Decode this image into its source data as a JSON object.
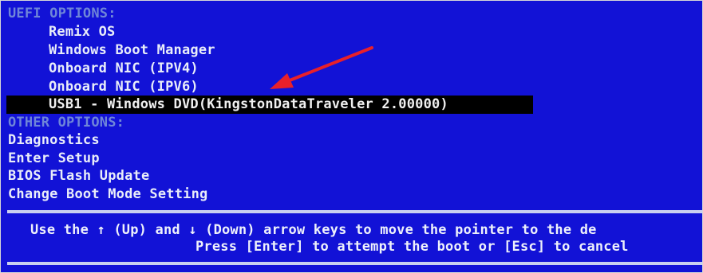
{
  "uefi": {
    "header": "UEFI OPTIONS:",
    "items": [
      "Remix OS",
      "Windows Boot Manager",
      "Onboard NIC (IPV4)",
      "Onboard NIC (IPV6)"
    ],
    "selected_item": "USB1 - Windows DVD(KingstonDataTraveler 2.00000)"
  },
  "other": {
    "header": "OTHER OPTIONS:",
    "items": [
      "Diagnostics",
      "Enter Setup",
      "BIOS Flash Update",
      "Change Boot Mode Setting"
    ]
  },
  "footer": {
    "line1": "Use the ↑ (Up) and ↓ (Down) arrow keys to move the pointer to the de",
    "line2": "Press [Enter] to attempt the boot or [Esc] to cancel"
  },
  "colors": {
    "background": "#1212d6",
    "header_text": "#6f86d8",
    "item_text": "#e9edf9",
    "selection_bg": "#000000",
    "annotation_arrow": "#e8202a"
  },
  "icons": {
    "annotation": "red-arrow-icon"
  }
}
